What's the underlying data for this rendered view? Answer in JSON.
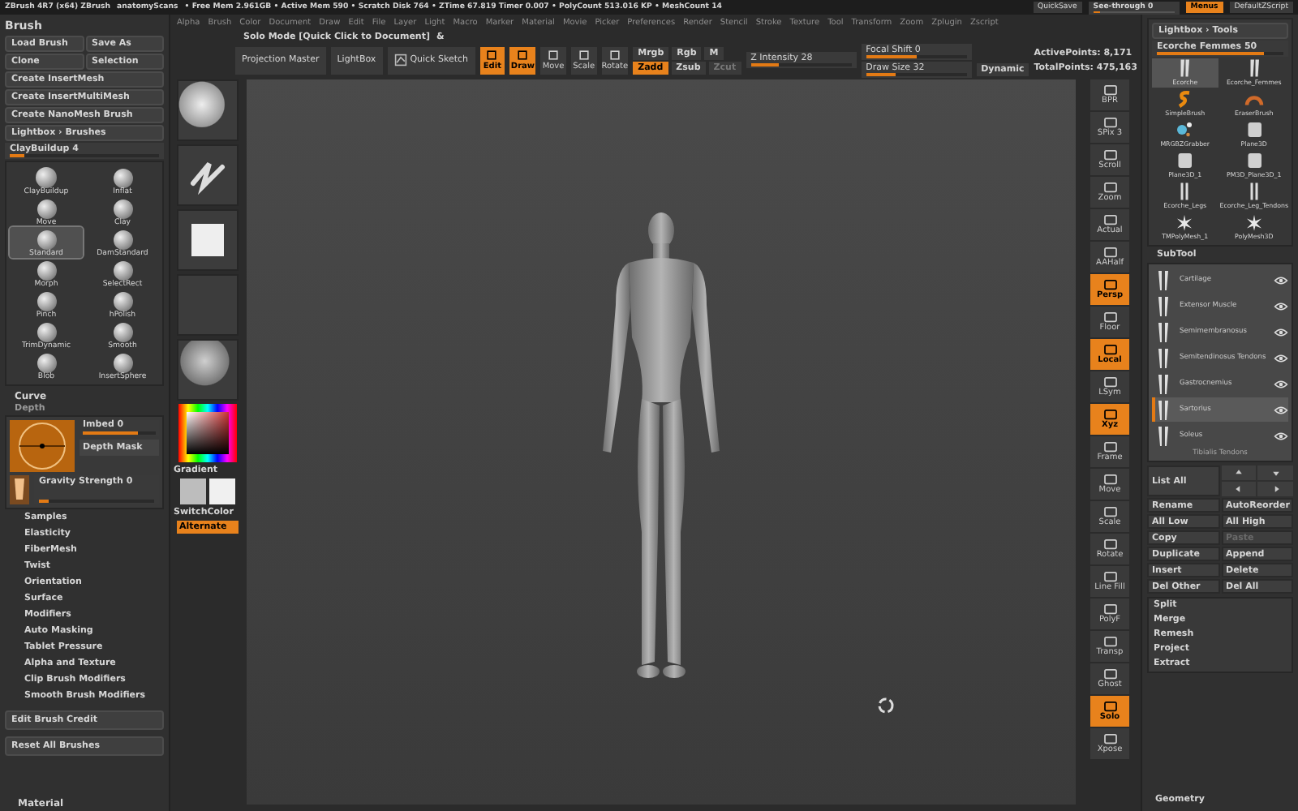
{
  "title_bar": {
    "app": "ZBrush 4R7 (x64) ZBrush",
    "document": "anatomyScans",
    "stats": "• Free Mem 2.961GB • Active Mem 590 • Scratch Disk 764 • ZTime 67.819 Timer 0.007 • PolyCount 513.016 KP • MeshCount 14",
    "quicksave": "QuickSave",
    "see_through": {
      "label": "See-through 0",
      "level": 0.08
    },
    "menus": {
      "label": "Menus",
      "on": true
    },
    "script": "DefaultZScript"
  },
  "menu_bar": [
    "Alpha",
    "Brush",
    "Color",
    "Document",
    "Draw",
    "Edit",
    "File",
    "Layer",
    "Light",
    "Macro",
    "Marker",
    "Material",
    "Movie",
    "Picker",
    "Preferences",
    "Render",
    "Stencil",
    "Stroke",
    "Texture",
    "Tool",
    "Transform",
    "Zoom",
    "Zplugin",
    "Zscript"
  ],
  "solo_mode": {
    "label": "Solo Mode [Quick Click to Document]",
    "key": "&"
  },
  "toolbar": {
    "buttons": [
      {
        "label": "Projection Master",
        "kind": "text"
      },
      {
        "label": "LightBox",
        "kind": "text"
      },
      {
        "label": "Quick Sketch",
        "kind": "sketch"
      }
    ],
    "modes": [
      {
        "label": "Edit",
        "on": true
      },
      {
        "label": "Draw",
        "on": true
      },
      {
        "label": "Move",
        "on": false
      },
      {
        "label": "Scale",
        "on": false
      },
      {
        "label": "Rotate",
        "on": false
      }
    ],
    "color_modes": [
      {
        "label": "Mrgb",
        "on": false
      },
      {
        "label": "Rgb",
        "on": false
      },
      {
        "label": "M",
        "on": false
      }
    ],
    "z_modes": [
      {
        "label": "Zadd",
        "on": true,
        "disabled": false
      },
      {
        "label": "Zsub",
        "on": false,
        "disabled": false
      },
      {
        "label": "Zcut",
        "on": false,
        "disabled": true
      }
    ],
    "z_intensity": {
      "label": "Z Intensity 28",
      "level": 0.28
    },
    "focal_shift": {
      "label": "Focal Shift 0",
      "level": 0.5
    },
    "draw_size": {
      "label": "Draw Size 32",
      "level": 0.3
    },
    "dynamic": "Dynamic",
    "active_points": "ActivePoints: 8,171",
    "total_points": "TotalPoints: 475,163"
  },
  "brush_palette": {
    "title": "Brush",
    "buttons": [
      "Load Brush",
      "Save As",
      "Clone",
      "Selection"
    ],
    "wide_buttons": [
      "Create InsertMesh",
      "Create InsertMultiMesh",
      "Create NanoMesh Brush",
      "Lightbox › Brushes"
    ],
    "current": {
      "label": "ClayBuildup 4",
      "level": 0.1
    },
    "brushes": [
      {
        "name": "ClayBuildup",
        "selected": false
      },
      {
        "name": "Inflat",
        "selected": false
      },
      {
        "name": "Move",
        "selected": false
      },
      {
        "name": "Clay",
        "selected": false
      },
      {
        "name": "Standard",
        "selected": true
      },
      {
        "name": "DamStandard",
        "selected": false
      },
      {
        "name": "Morph",
        "selected": false
      },
      {
        "name": "SelectRect",
        "selected": false
      },
      {
        "name": "Pinch",
        "selected": false
      },
      {
        "name": "hPolish",
        "selected": false
      },
      {
        "name": "TrimDynamic",
        "selected": false
      },
      {
        "name": "Smooth",
        "selected": false
      },
      {
        "name": "Blob",
        "selected": false
      },
      {
        "name": "InsertSphere",
        "selected": false
      }
    ],
    "curve": "Curve",
    "depth": "Depth",
    "imbed": {
      "label": "Imbed 0",
      "level": 0.75
    },
    "depth_mask": "Depth Mask",
    "gravity": {
      "label": "Gravity Strength 0",
      "level": 0.08
    },
    "sections": [
      "Samples",
      "Elasticity",
      "FiberMesh",
      "Twist",
      "Orientation",
      "Surface",
      "Modifiers",
      "Auto Masking",
      "Tablet Pressure",
      "Alpha and Texture",
      "Clip Brush Modifiers",
      "Smooth Brush Modifiers"
    ],
    "footer_buttons": [
      "Edit Brush Credit",
      "Reset All Brushes"
    ],
    "material": "Material"
  },
  "quick_palette": {
    "gradient": "Gradient",
    "switch_color": "SwitchColor",
    "alternate": {
      "label": "Alternate",
      "on": true
    }
  },
  "shelf": [
    {
      "label": "BPR",
      "on": false
    },
    {
      "label": "SPix 3",
      "on": false
    },
    {
      "label": "Scroll",
      "on": false
    },
    {
      "label": "Zoom",
      "on": false
    },
    {
      "label": "Actual",
      "on": false
    },
    {
      "label": "AAHalf",
      "on": false
    },
    {
      "label": "Persp",
      "on": true
    },
    {
      "label": "Floor",
      "on": false
    },
    {
      "label": "Local",
      "on": true
    },
    {
      "label": "LSym",
      "on": false
    },
    {
      "label": "Xyz",
      "on": true
    },
    {
      "label": "Frame",
      "on": false
    },
    {
      "label": "Move",
      "on": false
    },
    {
      "label": "Scale",
      "on": false
    },
    {
      "label": "Rotate",
      "on": false
    },
    {
      "label": "Line Fill",
      "on": false
    },
    {
      "label": "PolyF",
      "on": false
    },
    {
      "label": "Transp",
      "on": false
    },
    {
      "label": "Ghost",
      "on": false
    },
    {
      "label": "Solo",
      "on": true
    },
    {
      "label": "Xpose",
      "on": false
    }
  ],
  "tool_palette": {
    "title": "Lightbox › Tools",
    "current": {
      "label": "Ecorche Femmes 50",
      "level": 0.85
    },
    "tools": [
      {
        "name": "Ecorche",
        "kind": "figure",
        "selected": true
      },
      {
        "name": "Ecorche_Femmes",
        "kind": "figure",
        "selected": false
      },
      {
        "name": "SimpleBrush",
        "kind": "s",
        "selected": false
      },
      {
        "name": "EraserBrush",
        "kind": "ring",
        "selected": false
      },
      {
        "name": "MRGBZGrabber",
        "kind": "dots",
        "selected": false
      },
      {
        "name": "Plane3D",
        "kind": "plane",
        "selected": false
      },
      {
        "name": "Plane3D_1",
        "kind": "plane",
        "selected": false
      },
      {
        "name": "PM3D_Plane3D_1",
        "kind": "plane",
        "selected": false
      },
      {
        "name": "Ecorche_Legs",
        "kind": "legs",
        "selected": false
      },
      {
        "name": "Ecorche_Leg_Tendons",
        "kind": "legs",
        "selected": false
      },
      {
        "name": "TMPolyMesh_1",
        "kind": "star",
        "selected": false
      },
      {
        "name": "PolyMesh3D",
        "kind": "star",
        "selected": false
      }
    ]
  },
  "subtool": {
    "title": "SubTool",
    "items": [
      {
        "name": "Cartilage",
        "visible": true,
        "selected": false
      },
      {
        "name": "Extensor Muscle",
        "visible": true,
        "selected": false
      },
      {
        "name": "Semimembranosus",
        "visible": true,
        "selected": false
      },
      {
        "name": "Semitendinosus Tendons",
        "visible": true,
        "selected": false
      },
      {
        "name": "Gastrocnemius",
        "visible": true,
        "selected": false
      },
      {
        "name": "Sartorius",
        "visible": true,
        "selected": true
      },
      {
        "name": "Soleus",
        "visible": true,
        "selected": false
      }
    ],
    "footer": "Tibialis Tendons",
    "list_all": "List All",
    "buttons": [
      {
        "label": "Rename",
        "disabled": false
      },
      {
        "label": "AutoReorder",
        "disabled": false
      },
      {
        "label": "All Low",
        "disabled": false
      },
      {
        "label": "All High",
        "disabled": false
      },
      {
        "label": "Copy",
        "disabled": false
      },
      {
        "label": "Paste",
        "disabled": true
      },
      {
        "label": "Duplicate",
        "disabled": false
      },
      {
        "label": "Append",
        "disabled": false
      },
      {
        "label": "Insert",
        "disabled": false
      },
      {
        "label": "Delete",
        "disabled": false
      },
      {
        "label": "Del Other",
        "disabled": false
      },
      {
        "label": "Del All",
        "disabled": false
      }
    ],
    "actions": [
      "Split",
      "Merge",
      "Remesh",
      "Project",
      "Extract"
    ],
    "geometry": "Geometry"
  }
}
